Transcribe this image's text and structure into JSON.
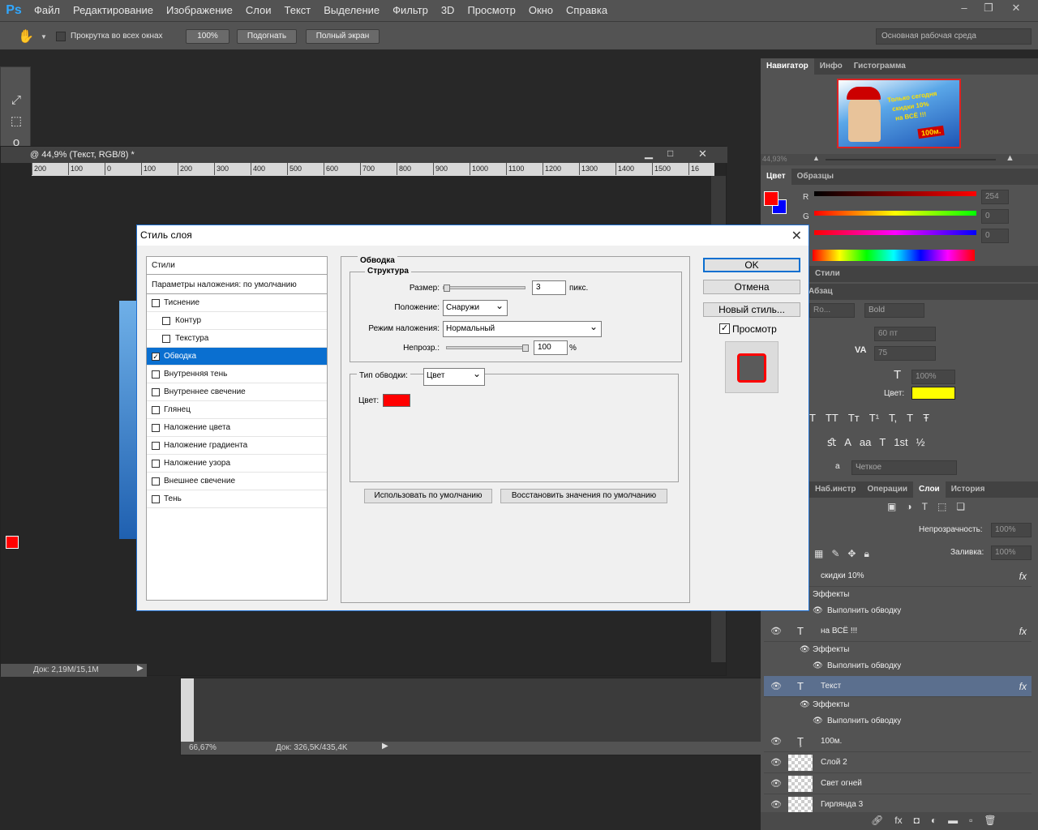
{
  "app": {
    "logo": "Ps"
  },
  "menu": [
    "Файл",
    "Редактирование",
    "Изображение",
    "Слои",
    "Текст",
    "Выделение",
    "Фильтр",
    "3D",
    "Просмотр",
    "Окно",
    "Справка"
  ],
  "window_controls": [
    "–",
    "❐",
    "✕"
  ],
  "options": {
    "scroll_all": "Прокрутка во всех окнах",
    "zoom100": "100%",
    "fit": "Подогнать",
    "fullscreen": "Полный экран",
    "workspace": "Основная рабочая среда"
  },
  "doc1": {
    "title": "@ 44,9% (Текст, RGB/8) *",
    "status": "Док: 2,19M/15,1M",
    "ruler": [
      "200",
      "100",
      "0",
      "100",
      "200",
      "300",
      "400",
      "500",
      "600",
      "700",
      "800",
      "900",
      "1000",
      "1100",
      "1200",
      "1300",
      "1400",
      "1500",
      "16"
    ]
  },
  "doc2": {
    "zoom": "66,67%",
    "status": "Док: 326,5K/435,4K"
  },
  "navigator": {
    "tabs": [
      "Навигатор",
      "Инфо",
      "Гистограмма"
    ],
    "zoom": "44,93%",
    "thumb_text": [
      "Только сегодня",
      "скидки 10%",
      "на ВСЁ !!!",
      "100м."
    ]
  },
  "color_panel": {
    "tabs": [
      "Цвет",
      "Образцы"
    ],
    "labels": {
      "r": "R",
      "g": "G",
      "b": "B"
    },
    "r": "254",
    "g": "0",
    "b": "0",
    "fg": "#ff0000",
    "bg": "#0000ff"
  },
  "styles_tabs": [
    "Стили"
  ],
  "char_panel": {
    "tab": "Абзац",
    "font": "Ro...",
    "style": "Bold",
    "size": "60 пт",
    "track": "75",
    "scale": "100%",
    "color_label": "Цвет:",
    "color": "#ffff00",
    "aa": "Четкое",
    "aa_label": "a",
    "glyphs": [
      "T",
      "TT",
      "Tт",
      "T¹",
      "T,",
      "T",
      "Ŧ"
    ],
    "glyphs2": [
      "ﬆ",
      "A",
      "aa",
      "T",
      "1st",
      "½"
    ]
  },
  "layers_tabs": [
    "Наб.инстр",
    "Операции",
    "Слои",
    "История"
  ],
  "layers_panel": {
    "opacity_label": "Непрозрачность:",
    "opacity": "100%",
    "fill_label": "Заливка:",
    "fill": "100%"
  },
  "layers": [
    {
      "name": "скидки 10%",
      "type": "text",
      "sub": [
        "Эффекты",
        "Выполнить обводку"
      ]
    },
    {
      "name": "на ВСЁ !!!",
      "type": "text",
      "sub": [
        "Эффекты",
        "Выполнить обводку"
      ]
    },
    {
      "name": "Текст",
      "type": "text",
      "selected": true,
      "sub": [
        "Эффекты",
        "Выполнить обводку"
      ]
    },
    {
      "name": "100м.",
      "type": "warp"
    },
    {
      "name": "Слой 2",
      "type": "pixel"
    },
    {
      "name": "Свет огней",
      "type": "pixel"
    },
    {
      "name": "Гирлянда 3",
      "type": "pixel"
    }
  ],
  "dialog": {
    "title": "Стиль слоя",
    "styles_header": "Стили",
    "blend_default": "Параметры наложения: по умолчанию",
    "items": [
      {
        "label": "Тиснение",
        "checked": false,
        "sub": false
      },
      {
        "label": "Контур",
        "checked": false,
        "sub": true
      },
      {
        "label": "Текстура",
        "checked": false,
        "sub": true
      },
      {
        "label": "Обводка",
        "checked": true,
        "sub": false,
        "selected": true
      },
      {
        "label": "Внутренняя тень",
        "checked": false,
        "sub": false
      },
      {
        "label": "Внутреннее свечение",
        "checked": false,
        "sub": false
      },
      {
        "label": "Глянец",
        "checked": false,
        "sub": false
      },
      {
        "label": "Наложение цвета",
        "checked": false,
        "sub": false
      },
      {
        "label": "Наложение градиента",
        "checked": false,
        "sub": false
      },
      {
        "label": "Наложение узора",
        "checked": false,
        "sub": false
      },
      {
        "label": "Внешнее свечение",
        "checked": false,
        "sub": false
      },
      {
        "label": "Тень",
        "checked": false,
        "sub": false
      }
    ],
    "section": "Обводка",
    "structure": "Структура",
    "size_label": "Размер:",
    "size": "3",
    "size_unit": "пикс.",
    "position_label": "Положение:",
    "position": "Снаружи",
    "blend_label": "Режим наложения:",
    "blend": "Нормальный",
    "opacity_label": "Непрозр.:",
    "opacity": "100",
    "opacity_unit": "%",
    "fill_type_label": "Тип обводки:",
    "fill_type": "Цвет",
    "color_label": "Цвет:",
    "stroke_color": "#ff0000",
    "make_default": "Использовать по умолчанию",
    "reset_default": "Восстановить значения по умолчанию",
    "ok": "OK",
    "cancel": "Отмена",
    "new_style": "Новый стиль...",
    "preview": "Просмотр"
  }
}
